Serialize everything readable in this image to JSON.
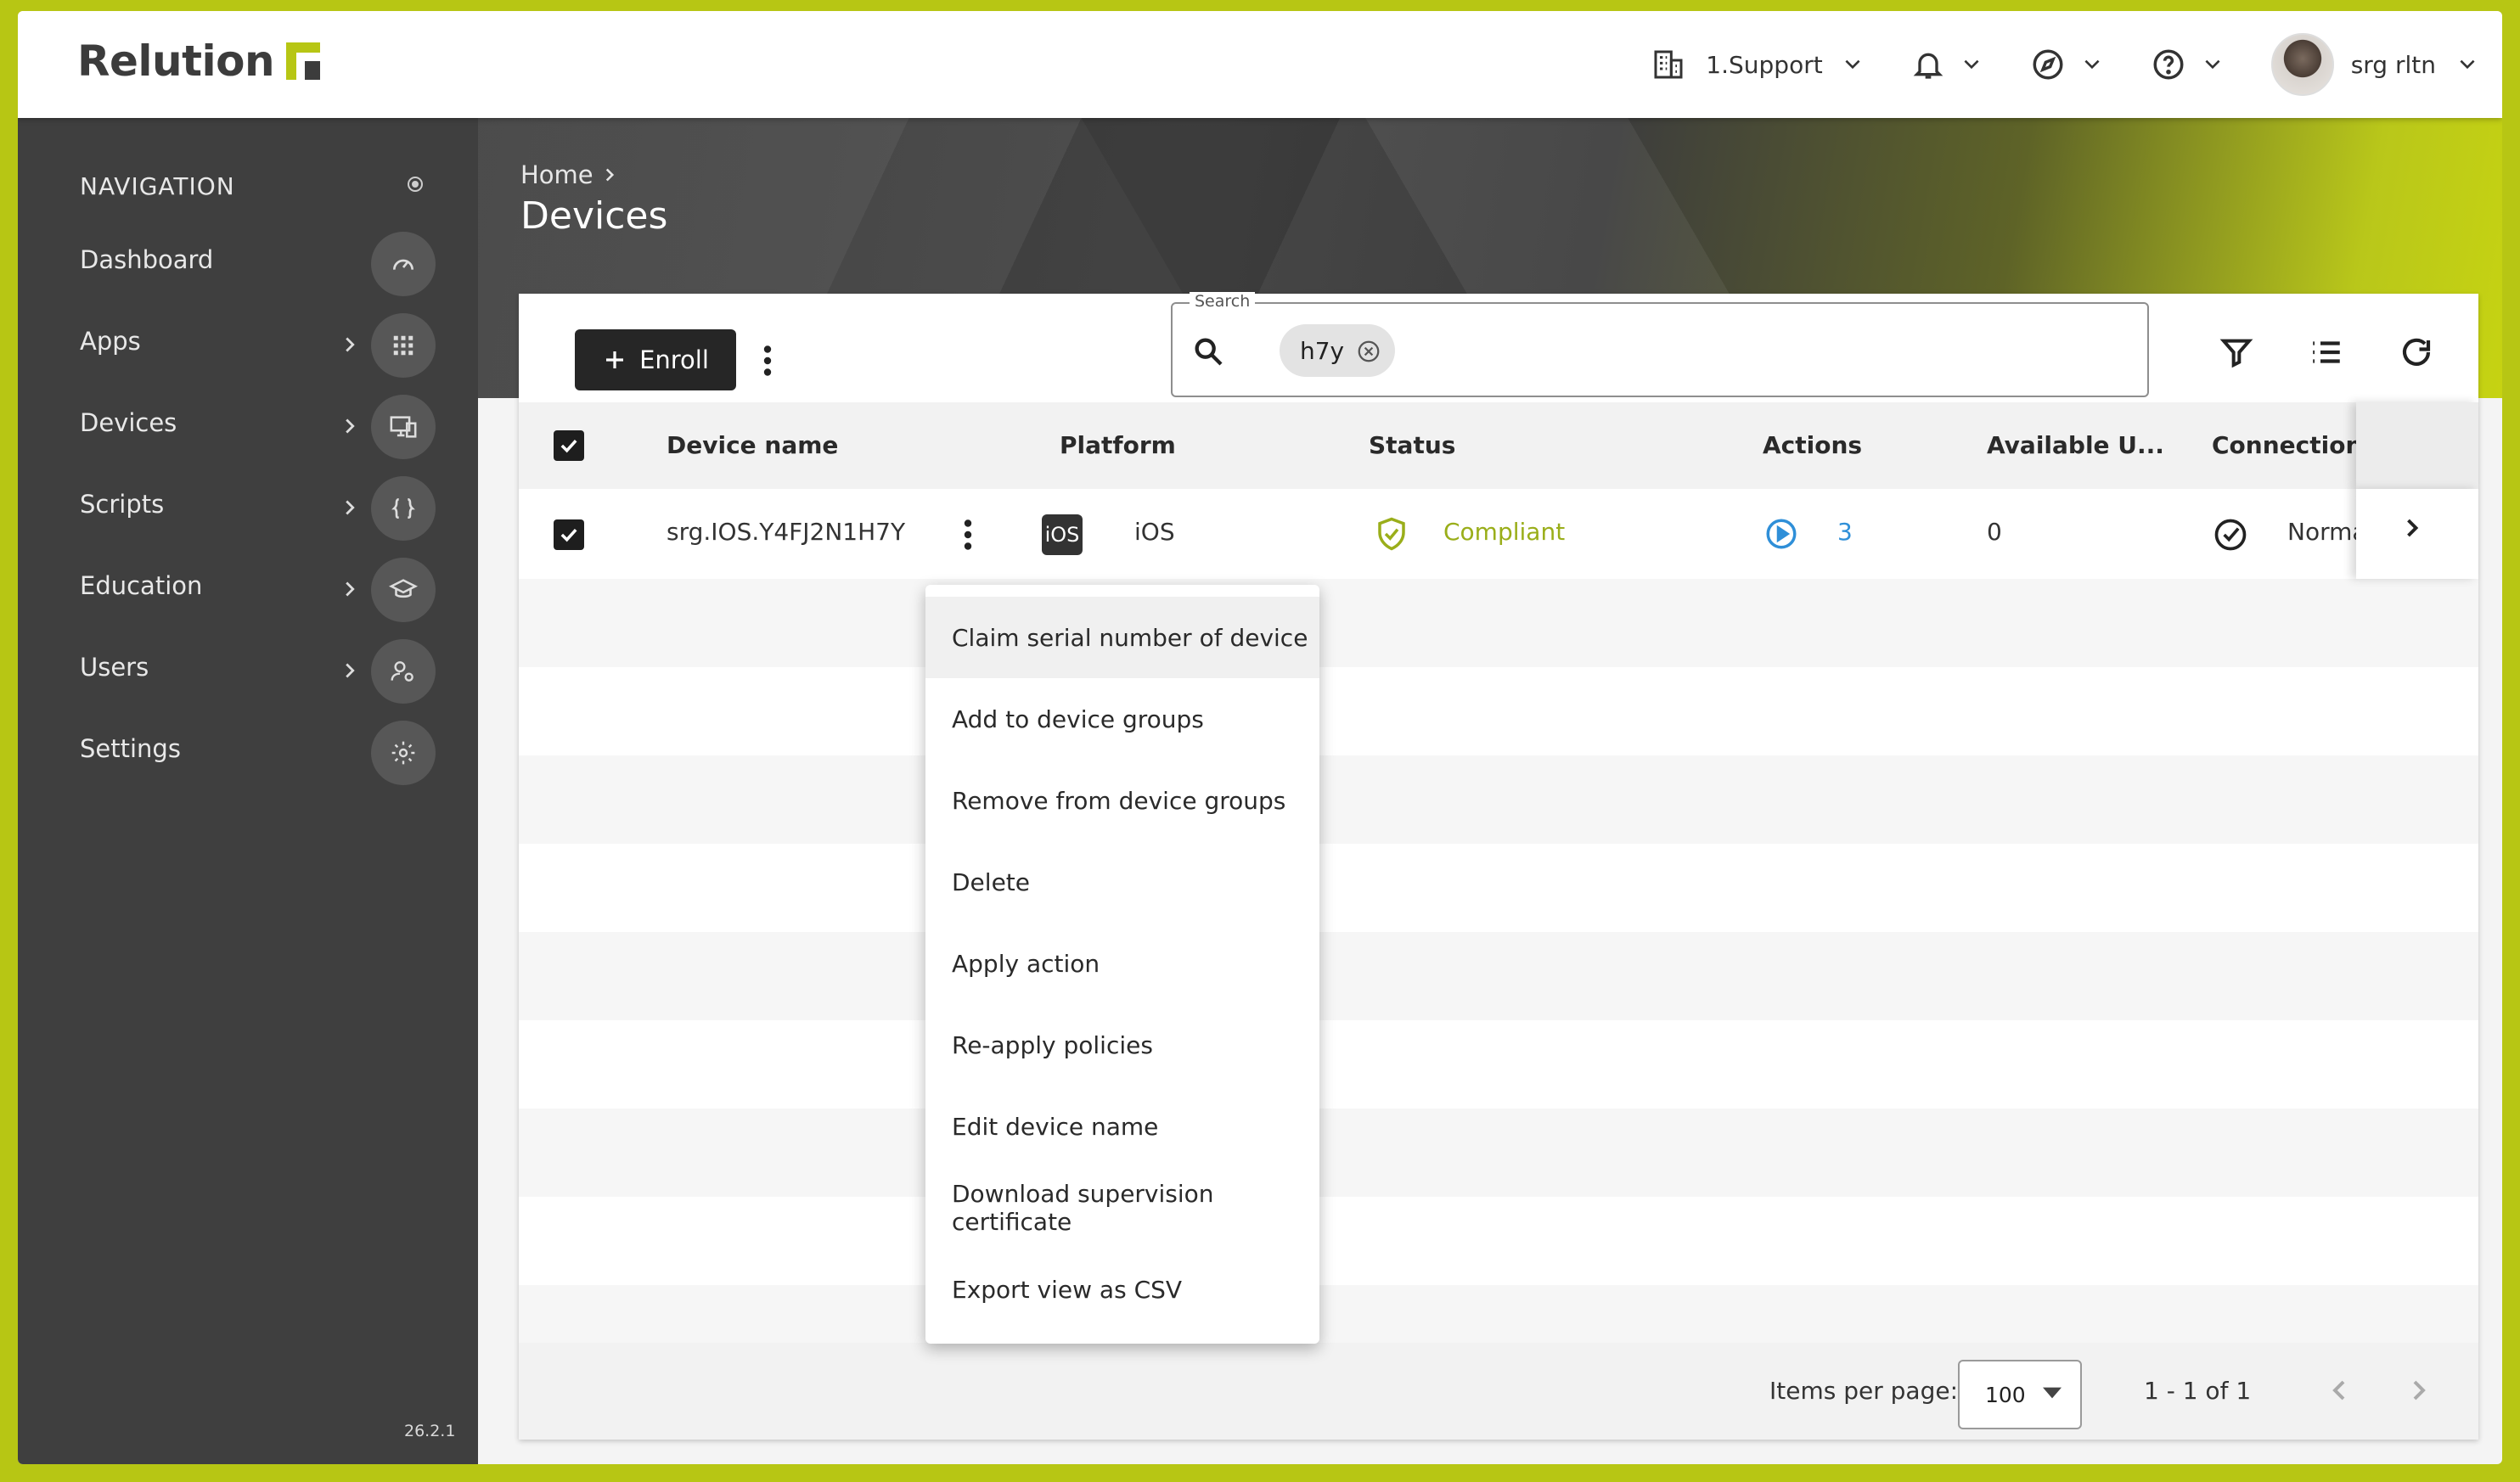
{
  "header": {
    "logo": "Relution",
    "org": "1.Support",
    "user": "srg rltn"
  },
  "sidebar": {
    "heading": "NAVIGATION",
    "items": [
      {
        "label": "Dashboard",
        "icon": "speedometer-icon",
        "has_children": false
      },
      {
        "label": "Apps",
        "icon": "grid-icon",
        "has_children": true
      },
      {
        "label": "Devices",
        "icon": "devices-icon",
        "has_children": true
      },
      {
        "label": "Scripts",
        "icon": "braces-icon",
        "has_children": true
      },
      {
        "label": "Education",
        "icon": "graduation-cap-icon",
        "has_children": true
      },
      {
        "label": "Users",
        "icon": "user-gear-icon",
        "has_children": true
      },
      {
        "label": "Settings",
        "icon": "gear-icon",
        "has_children": false
      }
    ],
    "version": "26.2.1"
  },
  "breadcrumb": {
    "home": "Home"
  },
  "page": {
    "title": "Devices"
  },
  "toolbar": {
    "enroll_label": "Enroll",
    "search_legend": "Search",
    "search_chip": "h7y"
  },
  "table": {
    "columns": [
      "Device name",
      "Platform",
      "Status",
      "Actions",
      "Available U...",
      "Connection sta"
    ],
    "rows": [
      {
        "device_name": "srg.IOS.Y4FJ2N1H7Y",
        "platform_badge": "iOS",
        "platform": "iOS",
        "status": "Compliant",
        "actions": "3",
        "available": "0",
        "connection": "Normal"
      }
    ]
  },
  "context_menu": {
    "items": [
      "Claim serial number of device",
      "Add to device groups",
      "Remove from device groups",
      "Delete",
      "Apply action",
      "Re-apply policies",
      "Edit device name",
      "Download supervision certificate",
      "Export view as CSV"
    ]
  },
  "pagination": {
    "items_per_page_label": "Items per page:",
    "items_per_page": "100",
    "range": "1 - 1 of 1"
  },
  "colors": {
    "accent": "#b7c614",
    "sidebar": "#3f3f3f",
    "compliant": "#9aae1a",
    "link": "#2f8fd8"
  }
}
